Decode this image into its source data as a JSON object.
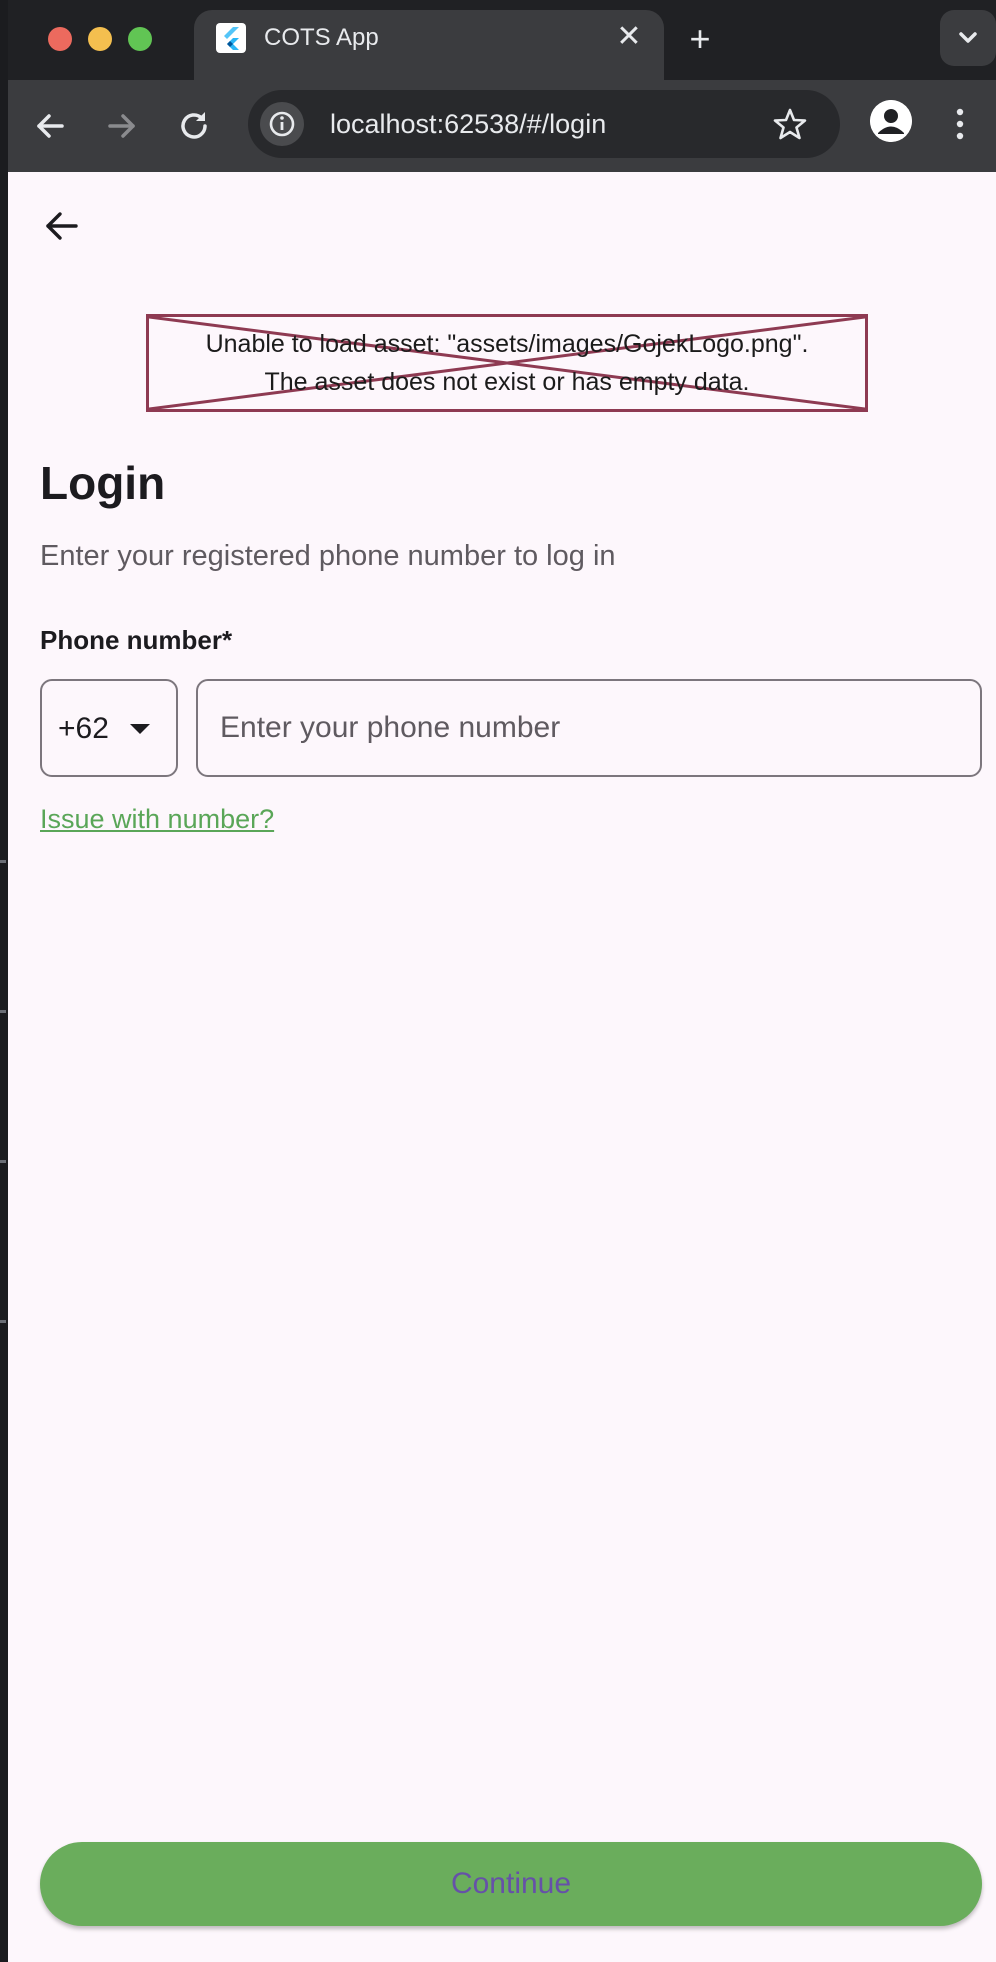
{
  "browser": {
    "tab_title": "COTS App",
    "tab_close": "✕",
    "new_tab": "+",
    "url": "localhost:62538/#/login"
  },
  "page": {
    "asset_error_line1": "Unable to load asset: \"assets/images/GojekLogo.png\".",
    "asset_error_line2": "The asset does not exist or has empty data.",
    "title": "Login",
    "subtitle": "Enter your registered phone number to log in",
    "phone_label": "Phone number*",
    "country_code": "+62",
    "phone_placeholder": "Enter your phone number",
    "phone_value": "",
    "issue_link": "Issue with number?",
    "continue_label": "Continue"
  },
  "colors": {
    "page_bg": "#fdf7fc",
    "accent_green": "#6aad5c",
    "link_green": "#5aa658",
    "button_text": "#6651a8",
    "error_border": "#8e3a52"
  },
  "icons": [
    "back-arrow-icon",
    "forward-arrow-icon",
    "reload-icon",
    "site-info-icon",
    "bookmark-star-icon",
    "profile-icon",
    "more-menu-icon",
    "flutter-favicon-icon",
    "chevron-down-icon",
    "dropdown-caret-icon"
  ]
}
